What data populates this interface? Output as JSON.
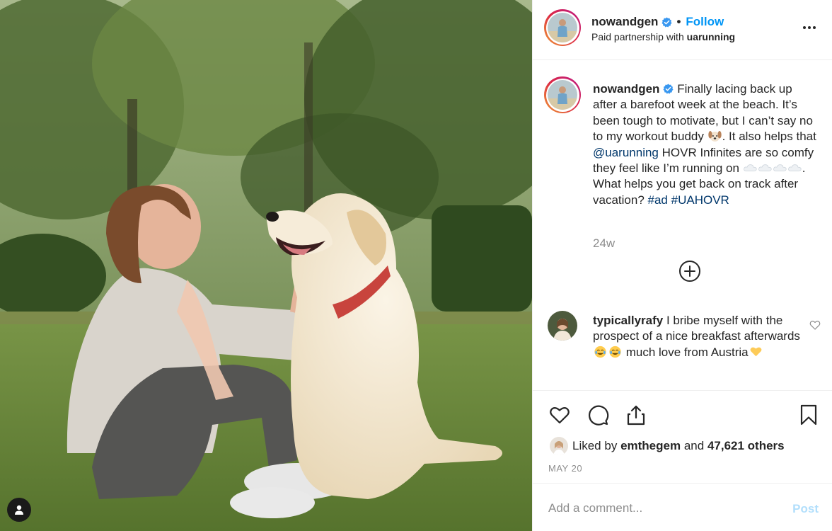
{
  "post": {
    "author": "nowandgen",
    "follow_label": "Follow",
    "separator": "•",
    "partnership_prefix": "Paid partnership with",
    "partner": "uarunning",
    "more_icon": "more-horizontal-icon"
  },
  "caption": {
    "author": "nowandgen",
    "text_1": "Finally lacing back up after a barefoot week at the beach. It’s been tough to motivate, but I can’t say no to my workout buddy",
    "text_2": ". It also helps that",
    "mention": "@uarunning",
    "text_3": "HOVR Infinites are so comfy they feel like I’m running on",
    "text_4": ". What helps you get back on track after vacation?",
    "tag_1": "#ad",
    "tag_2": "#UAHOVR",
    "time_ago": "24w"
  },
  "comment": {
    "author": "typicallyrafy",
    "text": "I bribe myself with the prospect of a nice breakfast afterwards",
    "text_2": "much love from Austria"
  },
  "likes": {
    "prefix": "Liked by",
    "user": "emthegem",
    "connector": "and",
    "others": "47,621 others"
  },
  "date": "MAY 20",
  "add_comment": {
    "placeholder": "Add a comment...",
    "post_label": "Post"
  },
  "colors": {
    "link_blue": "#0095f6",
    "mention_blue": "#00376b",
    "verified_blue": "#3897f0",
    "post_disabled": "#b2dffc",
    "secondary_text": "#8e8e8e"
  }
}
